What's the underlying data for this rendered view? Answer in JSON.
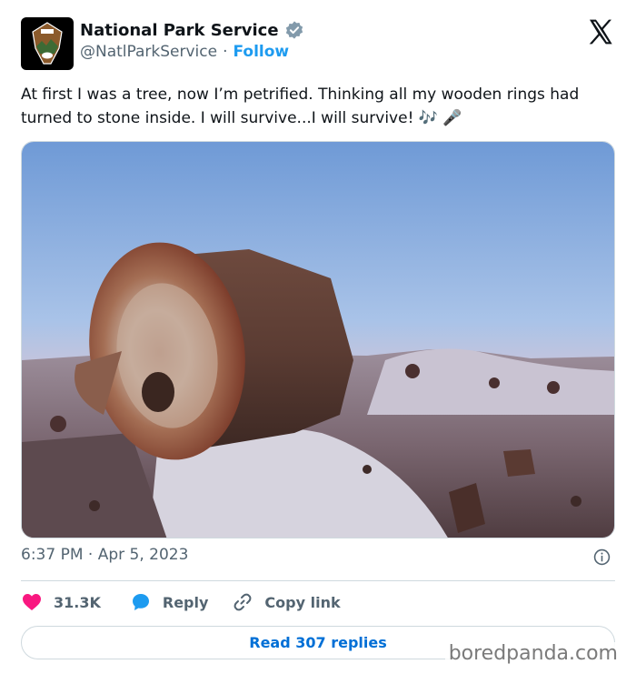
{
  "author": {
    "display_name": "National Park Service",
    "handle": "@NatlParkService",
    "separator": "·",
    "follow_label": "Follow",
    "avatar_icon": "nps-arrowhead-logo",
    "verified_icon": "verified-badge-icon"
  },
  "tweet": {
    "text": "At first I was a tree, now I’m petrified. Thinking all my wooden rings had turned to stone inside. I will survive...I will survive! 🎶 🎤",
    "media_description_icon": "petrified-log-photo",
    "timestamp": "6:37 PM · Apr 5, 2023"
  },
  "actions": {
    "likes_count": "31.3K",
    "reply_label": "Reply",
    "copy_link_label": "Copy link",
    "read_replies_label": "Read 307 replies"
  },
  "watermark": "boredpanda.com",
  "colors": {
    "like": "#f91880",
    "reply": "#1d9bf0",
    "follow": "#1d9bf0",
    "read_replies": "#006fd6",
    "secondary_text": "#536471"
  }
}
